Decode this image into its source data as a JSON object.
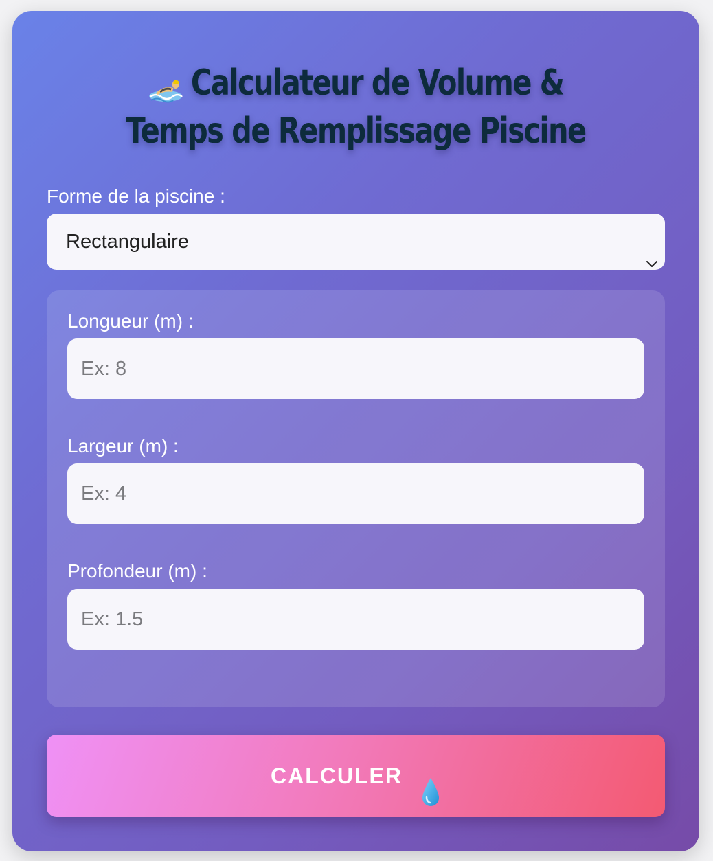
{
  "header": {
    "title": "Calculateur de Volume & Temps de Remplissage Piscine",
    "icon": "swimmer-icon"
  },
  "form": {
    "shape_label": "Forme de la piscine :",
    "shape_selected": "Rectangulaire",
    "fields": [
      {
        "label": "Longueur (m) :",
        "placeholder": "Ex: 8",
        "value": ""
      },
      {
        "label": "Largeur (m) :",
        "placeholder": "Ex: 4",
        "value": ""
      },
      {
        "label": "Profondeur (m) :",
        "placeholder": "Ex: 1.5",
        "value": ""
      }
    ]
  },
  "action": {
    "calculate_label": "CALCULER",
    "calculate_icon": "water-drop-icon"
  },
  "colors": {
    "title": "#0d2b3c",
    "card_gradient_start": "#6a82e8",
    "card_gradient_end": "#764ba8",
    "button_gradient_start": "#ef91f6",
    "button_gradient_end": "#f35a72",
    "drop": "#29a8e0"
  }
}
